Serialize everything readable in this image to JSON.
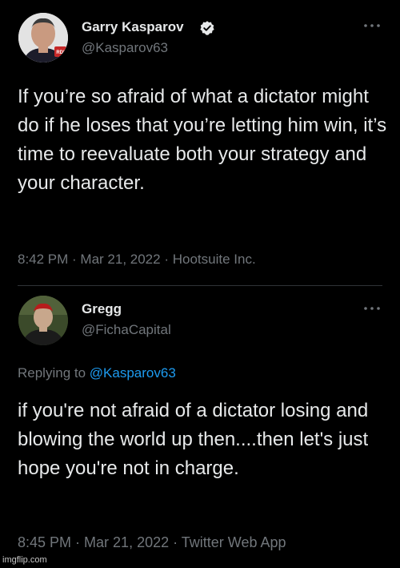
{
  "tweets": [
    {
      "display_name": "Garry Kasparov",
      "handle": "@Kasparov63",
      "verified": true,
      "text": "If you’re so afraid of what a dictator might do if he loses that you’re letting him win, it’s time to reevaluate both your strategy and your character.",
      "time": "8:42 PM",
      "date": "Mar 21, 2022",
      "source": "Hootsuite Inc.",
      "avatar_badge": "RDI"
    },
    {
      "display_name": "Gregg",
      "handle": "@FichaCapital",
      "verified": false,
      "replying_to_label": "Replying to",
      "replying_to_handle": "@Kasparov63",
      "text": "if you're not afraid of a dictator losing and blowing the world up then....then let's just hope you're not in charge.",
      "time": "8:45 PM",
      "date": "Mar 21, 2022",
      "source": "Twitter Web App"
    }
  ],
  "separator": " · ",
  "watermark": "imgflip.com",
  "icons": {
    "verified": "verified-badge-icon",
    "more": "more-options-icon"
  },
  "colors": {
    "background": "#000000",
    "text": "#e7e9ea",
    "secondary": "#71767b",
    "link": "#1d9bf0",
    "divider": "#2f3336"
  }
}
